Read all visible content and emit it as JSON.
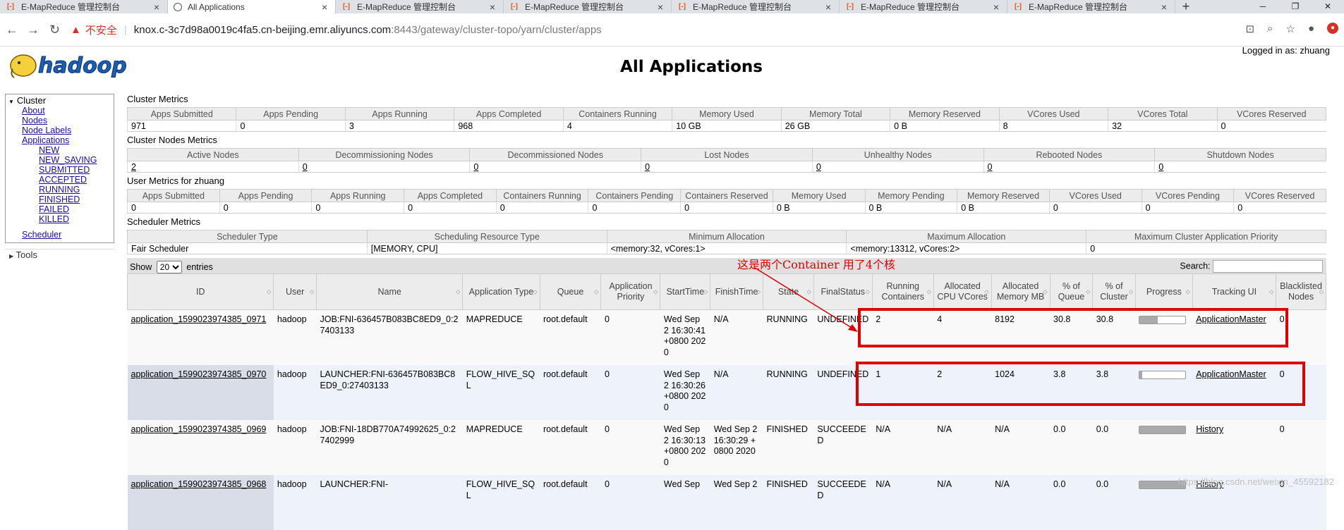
{
  "browser": {
    "tabs": [
      {
        "title": "E-MapReduce 管理控制台",
        "active": false
      },
      {
        "title": "All Applications",
        "active": true
      },
      {
        "title": "E-MapReduce 管理控制台",
        "active": false
      },
      {
        "title": "E-MapReduce 管理控制台",
        "active": false
      },
      {
        "title": "E-MapReduce 管理控制台",
        "active": false
      },
      {
        "title": "E-MapReduce 管理控制台",
        "active": false
      },
      {
        "title": "E-MapReduce 管理控制台",
        "active": false
      }
    ],
    "insecure_label": "不安全",
    "url_host": "knox.c-3c7d98a0019c4fa5.cn-beijing.emr.aliyuncs.com",
    "url_rest": ":8443/gateway/cluster-topo/yarn/cluster/apps"
  },
  "page": {
    "title": "All Applications",
    "logged_in": "Logged in as: zhuang"
  },
  "sidebar": {
    "cluster_label": "Cluster",
    "links": [
      "About",
      "Nodes",
      "Node Labels",
      "Applications"
    ],
    "app_states": [
      "NEW",
      "NEW_SAVING",
      "SUBMITTED",
      "ACCEPTED",
      "RUNNING",
      "FINISHED",
      "FAILED",
      "KILLED"
    ],
    "scheduler": "Scheduler",
    "tools": "Tools"
  },
  "cluster_metrics": {
    "title": "Cluster Metrics",
    "headers": [
      "Apps Submitted",
      "Apps Pending",
      "Apps Running",
      "Apps Completed",
      "Containers Running",
      "Memory Used",
      "Memory Total",
      "Memory Reserved",
      "VCores Used",
      "VCores Total",
      "VCores Reserved"
    ],
    "values": [
      "971",
      "0",
      "3",
      "968",
      "4",
      "10 GB",
      "26 GB",
      "0 B",
      "8",
      "32",
      "0"
    ]
  },
  "cluster_nodes_metrics": {
    "title": "Cluster Nodes Metrics",
    "headers": [
      "Active Nodes",
      "Decommissioning Nodes",
      "Decommissioned Nodes",
      "Lost Nodes",
      "Unhealthy Nodes",
      "Rebooted Nodes",
      "Shutdown Nodes"
    ],
    "values": [
      "2",
      "0",
      "0",
      "0",
      "0",
      "0",
      "0"
    ]
  },
  "user_metrics": {
    "title": "User Metrics for zhuang",
    "headers": [
      "Apps Submitted",
      "Apps Pending",
      "Apps Running",
      "Apps Completed",
      "Containers Running",
      "Containers Pending",
      "Containers Reserved",
      "Memory Used",
      "Memory Pending",
      "Memory Reserved",
      "VCores Used",
      "VCores Pending",
      "VCores Reserved"
    ],
    "values": [
      "0",
      "0",
      "0",
      "0",
      "0",
      "0",
      "0",
      "0 B",
      "0 B",
      "0 B",
      "0",
      "0",
      "0"
    ]
  },
  "scheduler_metrics": {
    "title": "Scheduler Metrics",
    "headers": [
      "Scheduler Type",
      "Scheduling Resource Type",
      "Minimum Allocation",
      "Maximum Allocation",
      "Maximum Cluster Application Priority"
    ],
    "values": [
      "Fair Scheduler",
      "[MEMORY, CPU]",
      "<memory:32, vCores:1>",
      "<memory:13312, vCores:2>",
      "0"
    ]
  },
  "controls": {
    "show_label": "Show",
    "entries_value": "20",
    "entries_label": "entries",
    "search_label": "Search:"
  },
  "apps_table": {
    "headers": [
      "ID",
      "User",
      "Name",
      "Application Type",
      "Queue",
      "Application Priority",
      "StartTime",
      "FinishTime",
      "State",
      "FinalStatus",
      "Running Containers",
      "Allocated CPU VCores",
      "Allocated Memory MB",
      "% of Queue",
      "% of Cluster",
      "Progress",
      "Tracking UI",
      "Blacklisted Nodes"
    ],
    "rows": [
      {
        "id": "application_1599023974385_0971",
        "user": "hadoop",
        "name": "JOB:FNI-636457B083BC8ED9_0:27403133",
        "type": "MAPREDUCE",
        "queue": "root.default",
        "priority": "0",
        "start": "Wed Sep 2 16:30:41 +0800 2020",
        "finish": "N/A",
        "state": "RUNNING",
        "final": "UNDEFINED",
        "containers": "2",
        "vcores": "4",
        "memory": "8192",
        "pct_queue": "30.8",
        "pct_cluster": "30.8",
        "progress": 0.4,
        "tracking": "ApplicationMaster",
        "blacklisted": "0"
      },
      {
        "id": "application_1599023974385_0970",
        "user": "hadoop",
        "name": "LAUNCHER:FNI-636457B083BC8ED9_0:27403133",
        "type": "FLOW_HIVE_SQL",
        "queue": "root.default",
        "priority": "0",
        "start": "Wed Sep 2 16:30:26 +0800 2020",
        "finish": "N/A",
        "state": "RUNNING",
        "final": "UNDEFINED",
        "containers": "1",
        "vcores": "2",
        "memory": "1024",
        "pct_queue": "3.8",
        "pct_cluster": "3.8",
        "progress": 0.05,
        "tracking": "ApplicationMaster",
        "blacklisted": "0"
      },
      {
        "id": "application_1599023974385_0969",
        "user": "hadoop",
        "name": "JOB:FNI-18DB770A74992625_0:27402999",
        "type": "MAPREDUCE",
        "queue": "root.default",
        "priority": "0",
        "start": "Wed Sep 2 16:30:13 +0800 2020",
        "finish": "Wed Sep 2 16:30:29 +0800 2020",
        "state": "FINISHED",
        "final": "SUCCEEDED",
        "containers": "N/A",
        "vcores": "N/A",
        "memory": "N/A",
        "pct_queue": "0.0",
        "pct_cluster": "0.0",
        "progress": 1.0,
        "tracking": "History",
        "blacklisted": "0"
      },
      {
        "id": "application_1599023974385_0968",
        "user": "hadoop",
        "name": "LAUNCHER:FNI-",
        "type": "FLOW_HIVE_SQL",
        "queue": "root.default",
        "priority": "0",
        "start": "Wed Sep",
        "finish": "Wed Sep 2",
        "state": "FINISHED",
        "final": "SUCCEEDED",
        "containers": "N/A",
        "vcores": "N/A",
        "memory": "N/A",
        "pct_queue": "0.0",
        "pct_cluster": "0.0",
        "progress": 1.0,
        "tracking": "History",
        "blacklisted": "0"
      }
    ]
  },
  "annotation": {
    "text": "这是两个Container  用了4个核",
    "color": "#e00000"
  },
  "watermark": "https://blog.csdn.net/weixin_45592182"
}
